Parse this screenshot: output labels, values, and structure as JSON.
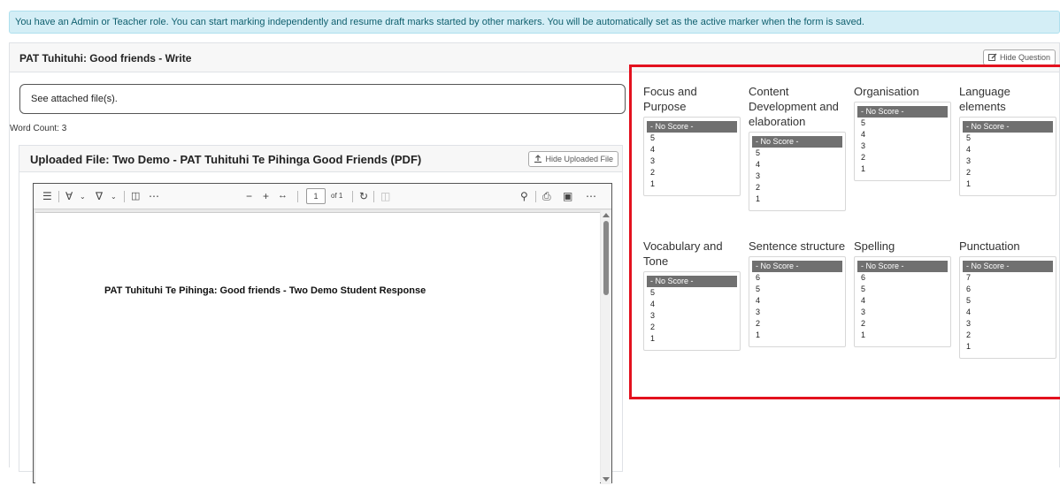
{
  "alert": {
    "text": "You have an Admin or Teacher role. You can start marking independently and resume draft marks started by other markers. You will be automatically set as the active marker when the form is saved."
  },
  "question": {
    "title": "PAT Tuhituhi: Good friends - Write",
    "hide_label": "Hide Question",
    "answer": "See attached file(s).",
    "word_count": "Word Count: 3"
  },
  "file": {
    "title": "Uploaded File: Two Demo - PAT Tuhituhi Te Pihinga Good Friends (PDF)",
    "hide_label": "Hide Uploaded File"
  },
  "pdf": {
    "page": "1",
    "of": "of 1",
    "heading": "PAT Tuhituhi Te Pihinga: Good friends - Two Demo Student Response"
  },
  "rubric": {
    "criteria": [
      {
        "title": "Focus and Purpose",
        "options": [
          "- No Score -",
          "5",
          "4",
          "3",
          "2",
          "1"
        ]
      },
      {
        "title": "Content Development and elaboration",
        "options": [
          "- No Score -",
          "5",
          "4",
          "3",
          "2",
          "1"
        ]
      },
      {
        "title": "Organisation",
        "options": [
          "- No Score -",
          "5",
          "4",
          "3",
          "2",
          "1"
        ]
      },
      {
        "title": "Language elements",
        "options": [
          "- No Score -",
          "5",
          "4",
          "3",
          "2",
          "1"
        ]
      },
      {
        "title": "Vocabulary and Tone",
        "options": [
          "- No Score -",
          "5",
          "4",
          "3",
          "2",
          "1"
        ]
      },
      {
        "title": "Sentence structure",
        "options": [
          "- No Score -",
          "6",
          "5",
          "4",
          "3",
          "2",
          "1"
        ]
      },
      {
        "title": "Spelling",
        "options": [
          "- No Score -",
          "6",
          "5",
          "4",
          "3",
          "2",
          "1"
        ]
      },
      {
        "title": "Punctuation",
        "options": [
          "- No Score -",
          "7",
          "6",
          "5",
          "4",
          "3",
          "2",
          "1"
        ]
      }
    ]
  },
  "colors": {
    "alert_bg": "#d4eef6",
    "highlight_border": "#e3111e",
    "selected_option": "#707070"
  }
}
